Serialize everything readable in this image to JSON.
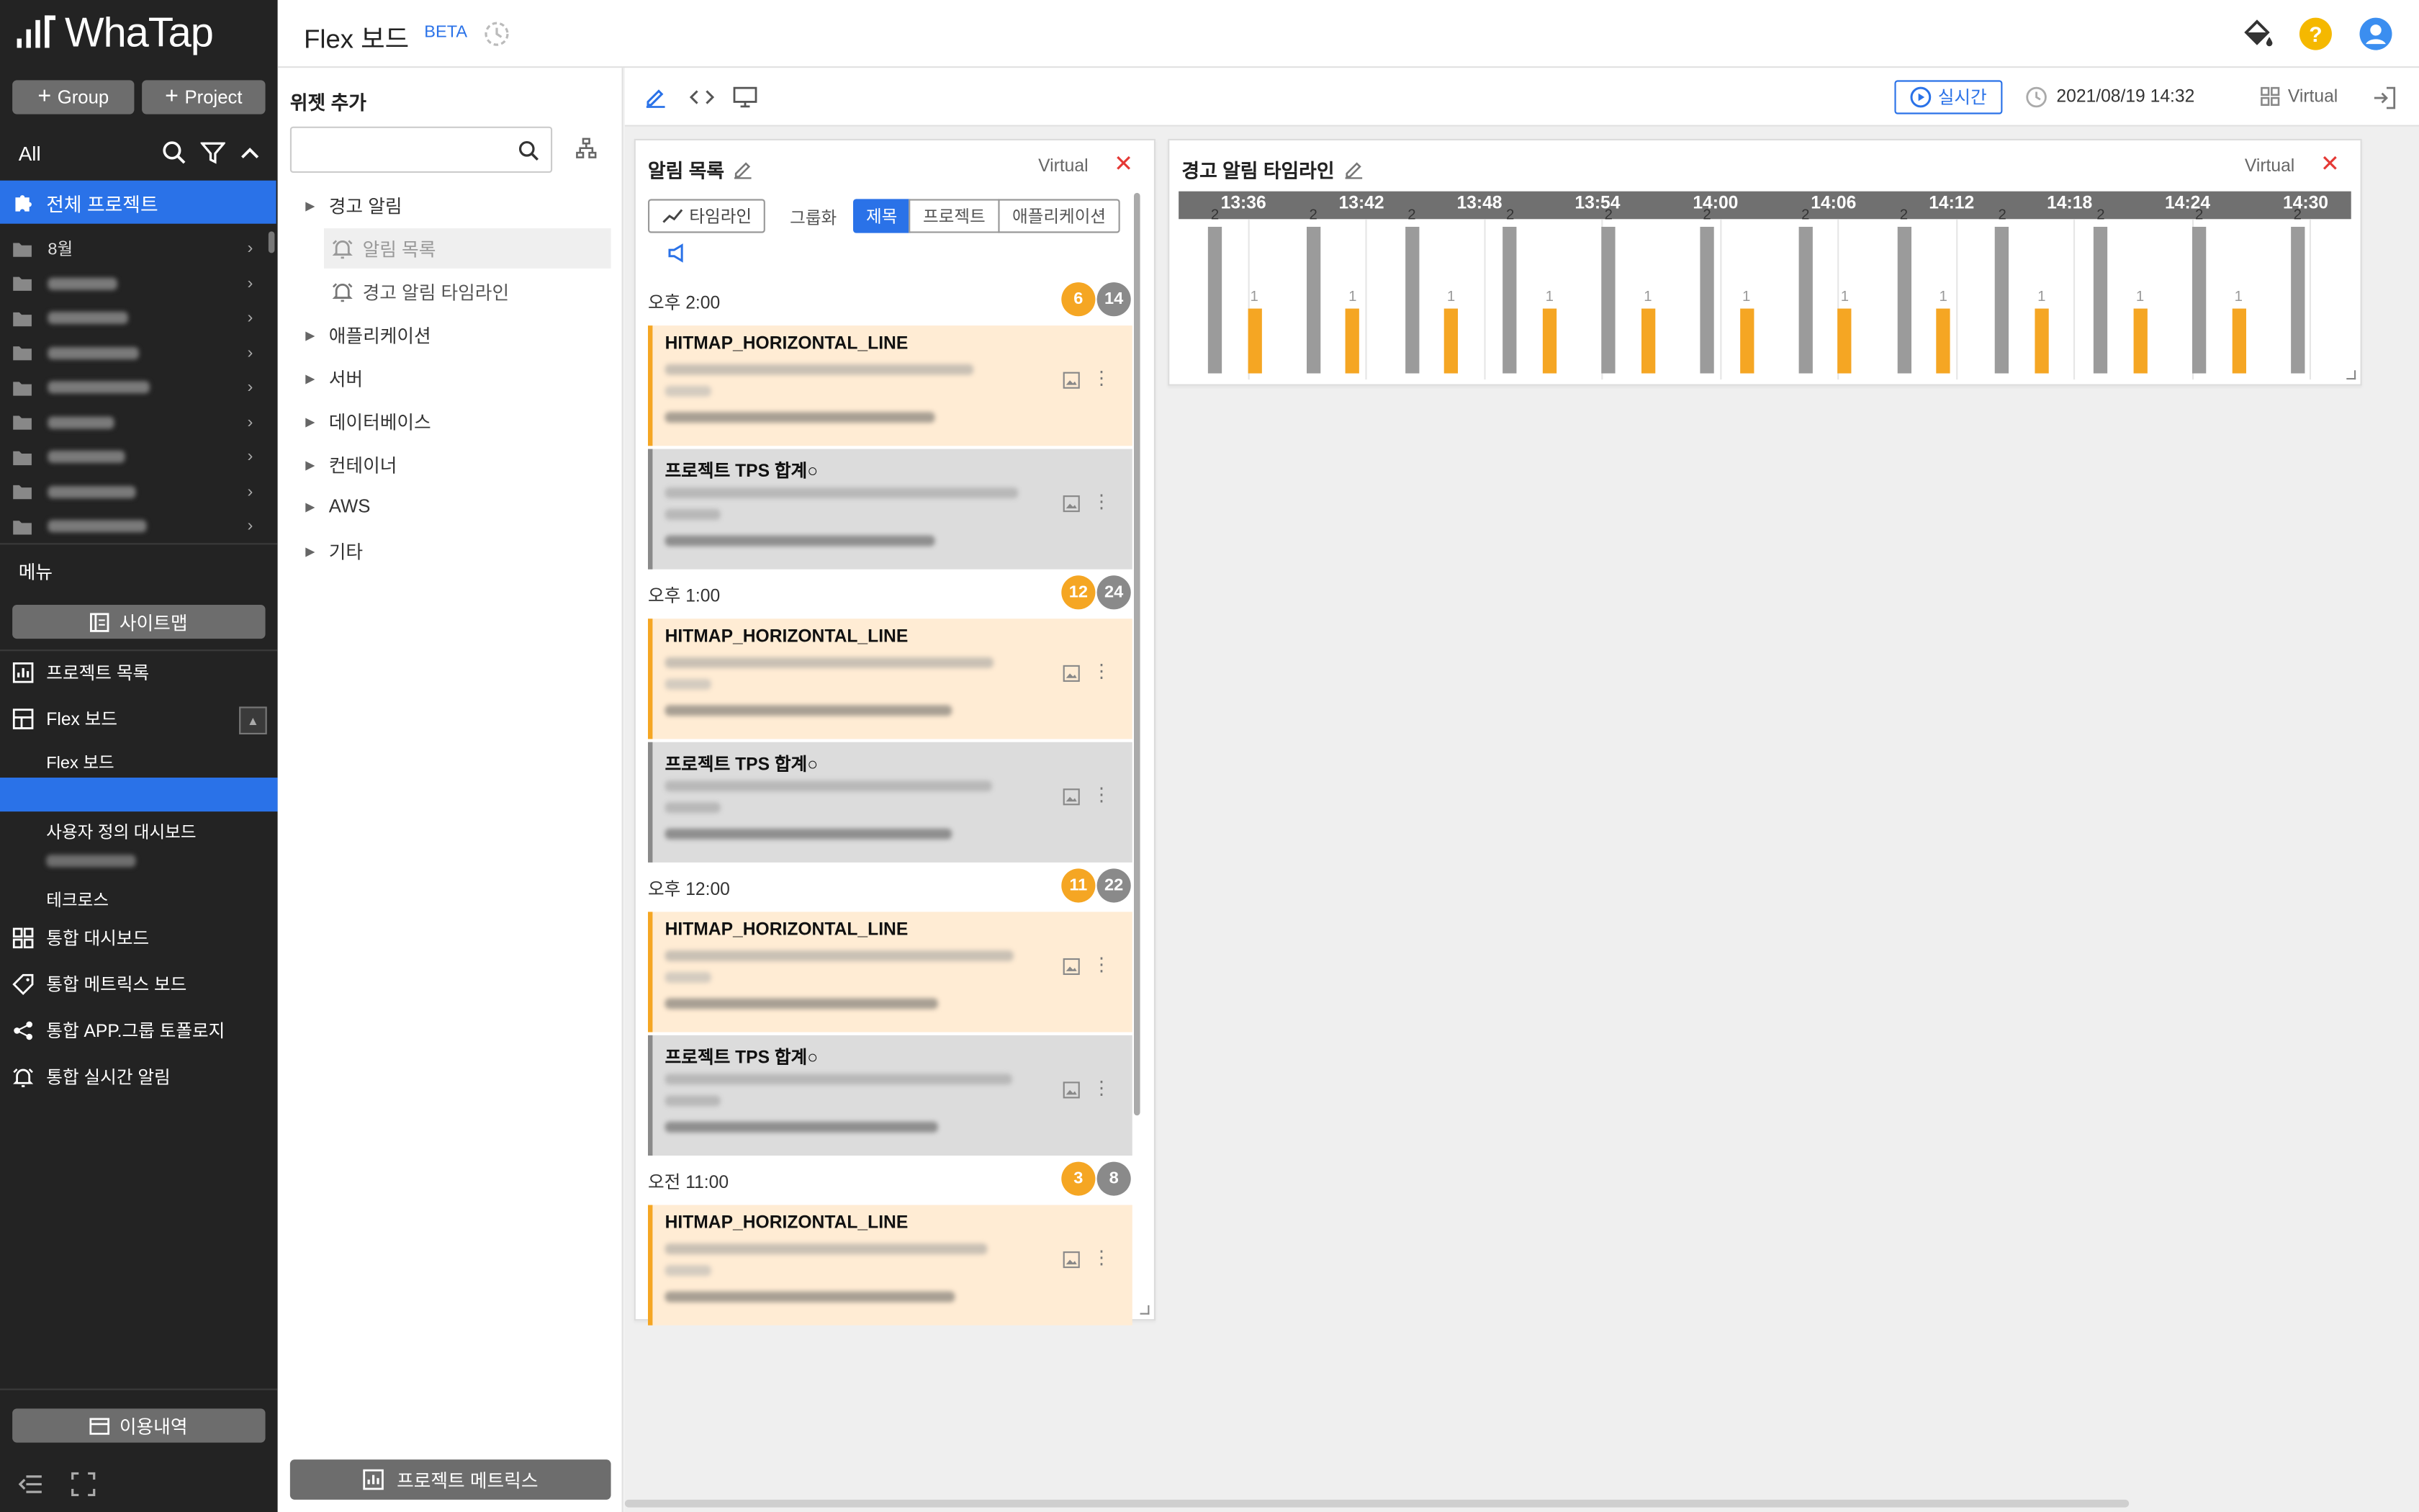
{
  "app": {
    "brand": "WhaTap",
    "page_title": "Flex 보드",
    "beta": "BETA"
  },
  "sidebar": {
    "group_btn": "Group",
    "project_btn": "Project",
    "all_label": "All",
    "all_projects": "전체 프로젝트",
    "folders": [
      {
        "label": "8월",
        "blurred": false
      },
      {
        "label": "EUNHA",
        "blurred": true
      },
      {
        "label": "GROUP_SEO",
        "blurred": true
      },
      {
        "label": "Hwanseok-Group",
        "blurred": true
      },
      {
        "label": "Hwanseok-Test-Group2",
        "blurred": true
      },
      {
        "label": "Hwanseok-Test-Group3",
        "blurred": true
      },
      {
        "label": "Kubernetes DEV",
        "blurred": true
      },
      {
        "label": "OTS SELF",
        "blurred": true
      },
      {
        "label": "PHP-DEMO",
        "blurred": true
      }
    ],
    "menu_label": "메뉴",
    "sitemap": "사이트맵",
    "project_list": "프로젝트 목록",
    "flex_board": "Flex 보드",
    "flex_board_sub": "Flex 보드",
    "custom_dashboard": "사용자 정의 대시보드",
    "blurred_sub": "honam_dev",
    "techcross": "테크로스",
    "integrated_dashboard": "통합 대시보드",
    "integrated_metrics": "통합 메트릭스 보드",
    "integrated_topology": "통합 APP.그룹 토폴로지",
    "integrated_alert": "통합 실시간 알림",
    "usage": "이용내역"
  },
  "widget_panel": {
    "title": "위젯 추가",
    "search_placeholder": "",
    "tree": {
      "alert": "경고 알림",
      "alert_list": "알림 목록",
      "alert_timeline": "경고 알림 타임라인",
      "application": "애플리케이션",
      "server": "서버",
      "database": "데이터베이스",
      "container": "컨테이너",
      "aws": "AWS",
      "etc": "기타"
    },
    "project_metrics": "프로젝트 메트릭스"
  },
  "toolbar": {
    "realtime": "실시간",
    "datetime": "2021/08/19 14:32",
    "project": "Virtual"
  },
  "alert_card": {
    "title": "알림 목록",
    "project": "Virtual",
    "timeline_btn": "타임라인",
    "grouping": "그룹화",
    "seg_title": "제목",
    "seg_project": "프로젝트",
    "seg_app": "애플리케이션",
    "groups": [
      {
        "time": "오후 2:00",
        "warn": "6",
        "total": "14",
        "items": [
          {
            "title": "HITMAP_HORIZONTAL_LINE",
            "kind": "warn",
            "line1": "Horizontal line detected on Hitmap (#5 on 5.75sec)",
            "line2": "08/19, 오후 2:28:59  Virtual  ▾  6/35"
          },
          {
            "title": "프로젝트 TPS 합계○",
            "kind": "info",
            "line1": "Virtual's TPS is 78.79166754218597",
            "line2": "08/19, 오후 2:30:42  Virtual  ▾  14/35"
          }
        ]
      },
      {
        "time": "오후 1:00",
        "warn": "12",
        "total": "24",
        "items": [
          {
            "title": "HITMAP_HORIZONTAL_LINE",
            "kind": "warn",
            "line1": "Horizontal line detected on Hitmap (#5 on 5.5sec)",
            "line2": "08/19, 오후 1:58:10  Virtual  ▾  12/36"
          },
          {
            "title": "프로젝트 TPS 합계○",
            "kind": "info",
            "line1": "Virtual's TPS is 74.1291673779487",
            "line2": "08/19, 오후 1:55:41  Virtual  ▾  24/36"
          }
        ]
      },
      {
        "time": "오후 12:00",
        "warn": "11",
        "total": "22",
        "items": [
          {
            "title": "HITMAP_HORIZONTAL_LINE",
            "kind": "warn",
            "line1": "Horizontal line detected on Hitmap (#5 on 6.0sec)",
            "line2": "08/19, 오후 12:56:33  Virtual  ▾  11/33"
          },
          {
            "title": "프로젝트 TPS 합계○",
            "kind": "info",
            "line1": "Virtual's TPS is 65.5857144764916",
            "line2": "08/19, 오후 12:50:39  Virtual  ▾  22/33"
          }
        ]
      },
      {
        "time": "오전 11:00",
        "warn": "3",
        "total": "8",
        "items": [
          {
            "title": "HITMAP_HORIZONTAL_LINE",
            "kind": "warn",
            "line1": "Horizontal line detected on Hitmap (#5 on 6.5sec)",
            "line2": ""
          }
        ]
      }
    ]
  },
  "timeline_card": {
    "title": "경고 알림 타임라인",
    "project": "Virtual",
    "ticks": [
      "13:36",
      "13:42",
      "13:48",
      "13:54",
      "14:00",
      "14:06",
      "14:12",
      "14:18",
      "14:24",
      "14:30"
    ],
    "bars": [
      {
        "grey": 2,
        "orange": 1
      },
      {
        "grey": 2,
        "orange": 1
      },
      {
        "grey": 2,
        "orange": 1
      },
      {
        "grey": 2,
        "orange": 1
      },
      {
        "grey": 2,
        "orange": 1
      },
      {
        "grey": 2,
        "orange": 1
      },
      {
        "grey": 2,
        "orange": 1
      },
      {
        "grey": 2,
        "orange": 1
      },
      {
        "grey": 2,
        "orange": 1
      },
      {
        "grey": 2,
        "orange": 1
      },
      {
        "grey": 2,
        "orange": 1
      },
      {
        "grey": 2,
        "orange": null
      }
    ]
  },
  "colors": {
    "accent": "#2a72e8",
    "warning": "#f5a623",
    "critical_bar": "#9b9b9b",
    "sidebar": "#232323"
  }
}
